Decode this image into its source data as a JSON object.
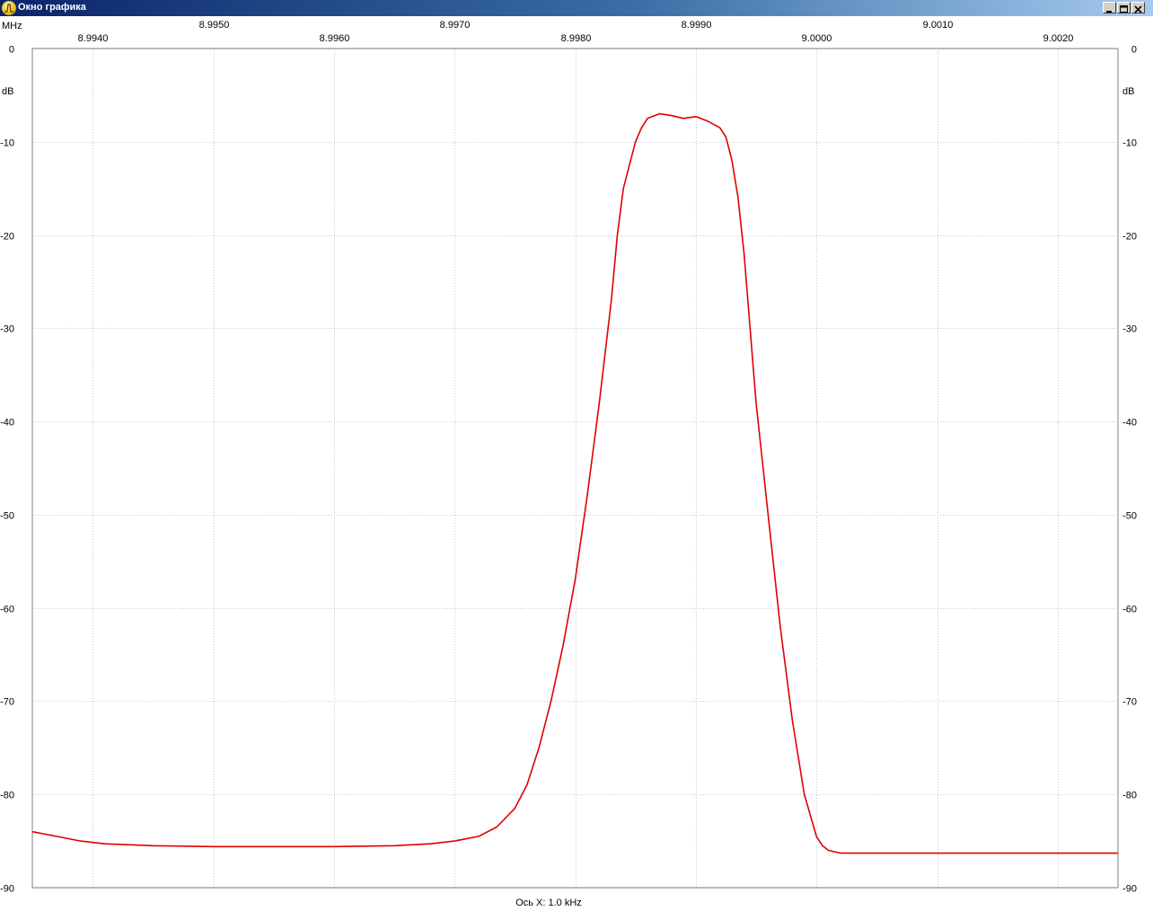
{
  "window": {
    "title": "Окно графика"
  },
  "chart_data": {
    "type": "line",
    "x_unit_label": "MHz",
    "y_unit_label": "dB",
    "x_axis_caption": "Ось X: 1.0 kHz",
    "xlim": [
      8.9935,
      9.0025
    ],
    "ylim": [
      -90,
      0
    ],
    "x_ticks": [
      8.994,
      8.995,
      8.996,
      8.997,
      8.998,
      8.999,
      9.0,
      9.001,
      9.002
    ],
    "x_tick_labels": [
      "8.9940",
      "8.9950",
      "8.9960",
      "8.9970",
      "8.9980",
      "8.9990",
      "9.0000",
      "9.0010",
      "9.0020"
    ],
    "y_ticks": [
      0,
      -10,
      -20,
      -30,
      -40,
      -50,
      -60,
      -70,
      -80,
      -90
    ],
    "y_tick_labels": [
      "0",
      "-10",
      "-20",
      "-30",
      "-40",
      "-50",
      "-60",
      "-70",
      "-80",
      "-90"
    ],
    "grid": true,
    "series": [
      {
        "color": "#e00000",
        "x": [
          8.9935,
          8.9937,
          8.9939,
          8.9941,
          8.9945,
          8.995,
          8.9955,
          8.996,
          8.9965,
          8.9968,
          8.997,
          8.9972,
          8.99735,
          8.9975,
          8.9976,
          8.9977,
          8.9978,
          8.99785,
          8.9979,
          8.998,
          8.9981,
          8.9982,
          8.9983,
          8.99835,
          8.9984,
          8.9985,
          8.99855,
          8.9986,
          8.9987,
          8.9988,
          8.9989,
          8.999,
          8.9991,
          8.9992,
          8.99925,
          8.9993,
          8.99935,
          8.9994,
          8.99945,
          8.9995,
          8.9996,
          8.9997,
          8.9998,
          8.9999,
          9.0,
          9.00005,
          9.0001,
          9.0002,
          9.0003,
          9.0004,
          9.0005,
          9.001,
          9.0015,
          9.002,
          9.0025
        ],
        "y": [
          -84.0,
          -84.5,
          -85.0,
          -85.3,
          -85.5,
          -85.6,
          -85.6,
          -85.6,
          -85.5,
          -85.3,
          -85.0,
          -84.5,
          -83.5,
          -81.5,
          -79.0,
          -75.0,
          -70.0,
          -67.0,
          -64.0,
          -57.0,
          -48.0,
          -38.0,
          -27.0,
          -20.0,
          -15.0,
          -10.0,
          -8.5,
          -7.5,
          -7.0,
          -7.2,
          -7.5,
          -7.3,
          -7.8,
          -8.5,
          -9.5,
          -12.0,
          -16.0,
          -22.0,
          -30.0,
          -38.0,
          -50.0,
          -62.0,
          -72.0,
          -80.0,
          -84.5,
          -85.5,
          -86.0,
          -86.3,
          -86.3,
          -86.3,
          -86.3,
          -86.3,
          -86.3,
          -86.3,
          -86.3
        ]
      }
    ]
  }
}
